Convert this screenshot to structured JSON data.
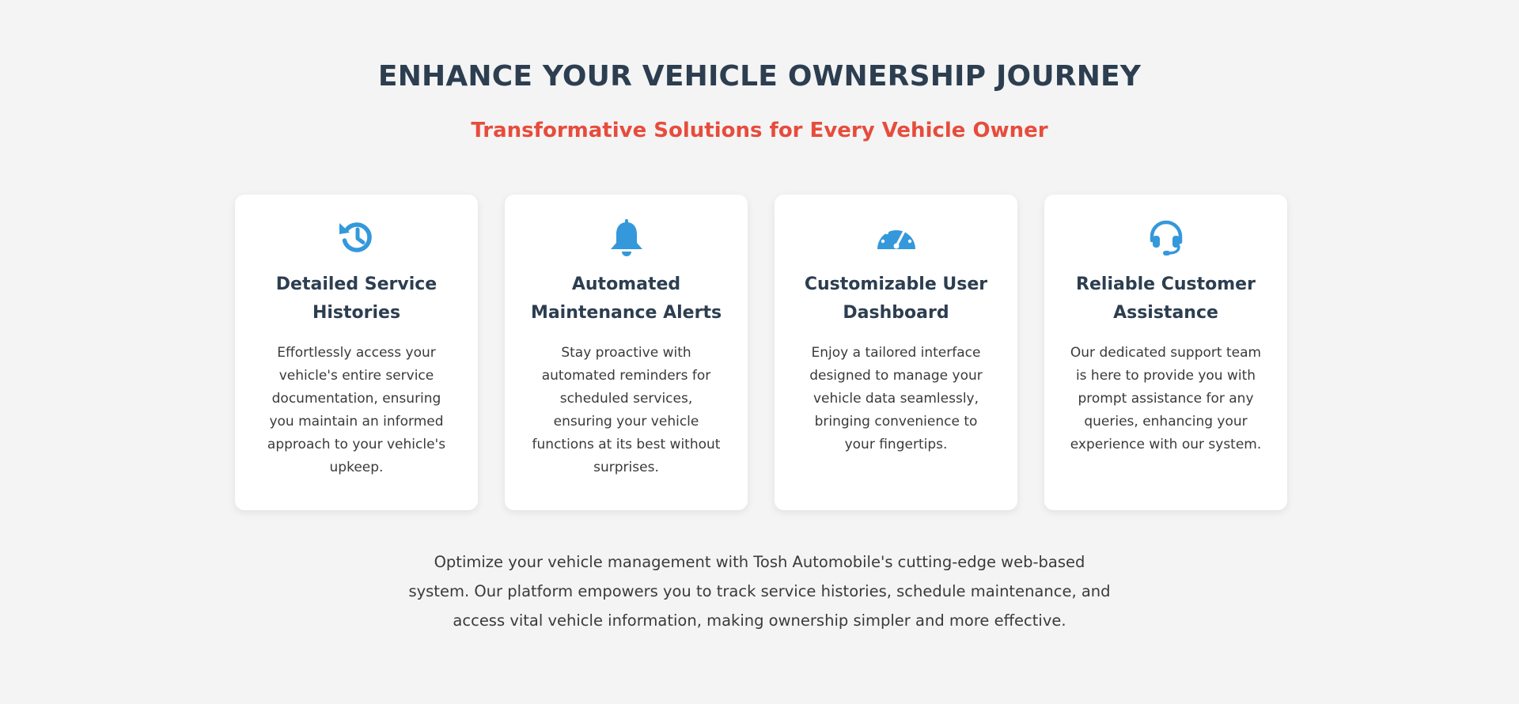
{
  "header": {
    "title": "ENHANCE YOUR VEHICLE OWNERSHIP JOURNEY",
    "subtitle": "Transformative Solutions for Every Vehicle Owner"
  },
  "colors": {
    "title": "#2c3e50",
    "subtitle": "#e74c3c",
    "icon": "#3498db",
    "background": "#f4f4f4",
    "card": "#ffffff"
  },
  "features": [
    {
      "icon": "history-icon",
      "title": "Detailed Service Histories",
      "text": "Effortlessly access your vehicle's entire service documentation, ensuring you maintain an informed approach to your vehicle's upkeep."
    },
    {
      "icon": "bell-icon",
      "title": "Automated Maintenance Alerts",
      "text": "Stay proactive with automated reminders for scheduled services, ensuring your vehicle functions at its best without surprises."
    },
    {
      "icon": "speedometer-icon",
      "title": "Customizable User Dashboard",
      "text": "Enjoy a tailored interface designed to manage your vehicle data seamlessly, bringing convenience to your fingertips."
    },
    {
      "icon": "headset-icon",
      "title": "Reliable Customer Assistance",
      "text": "Our dedicated support team is here to provide you with prompt assistance for any queries, enhancing your experience with our system."
    }
  ],
  "footer": {
    "text": "Optimize your vehicle management with Tosh Automobile's cutting-edge web-based system. Our platform empowers you to track service histories, schedule maintenance, and access vital vehicle information, making ownership simpler and more effective."
  }
}
